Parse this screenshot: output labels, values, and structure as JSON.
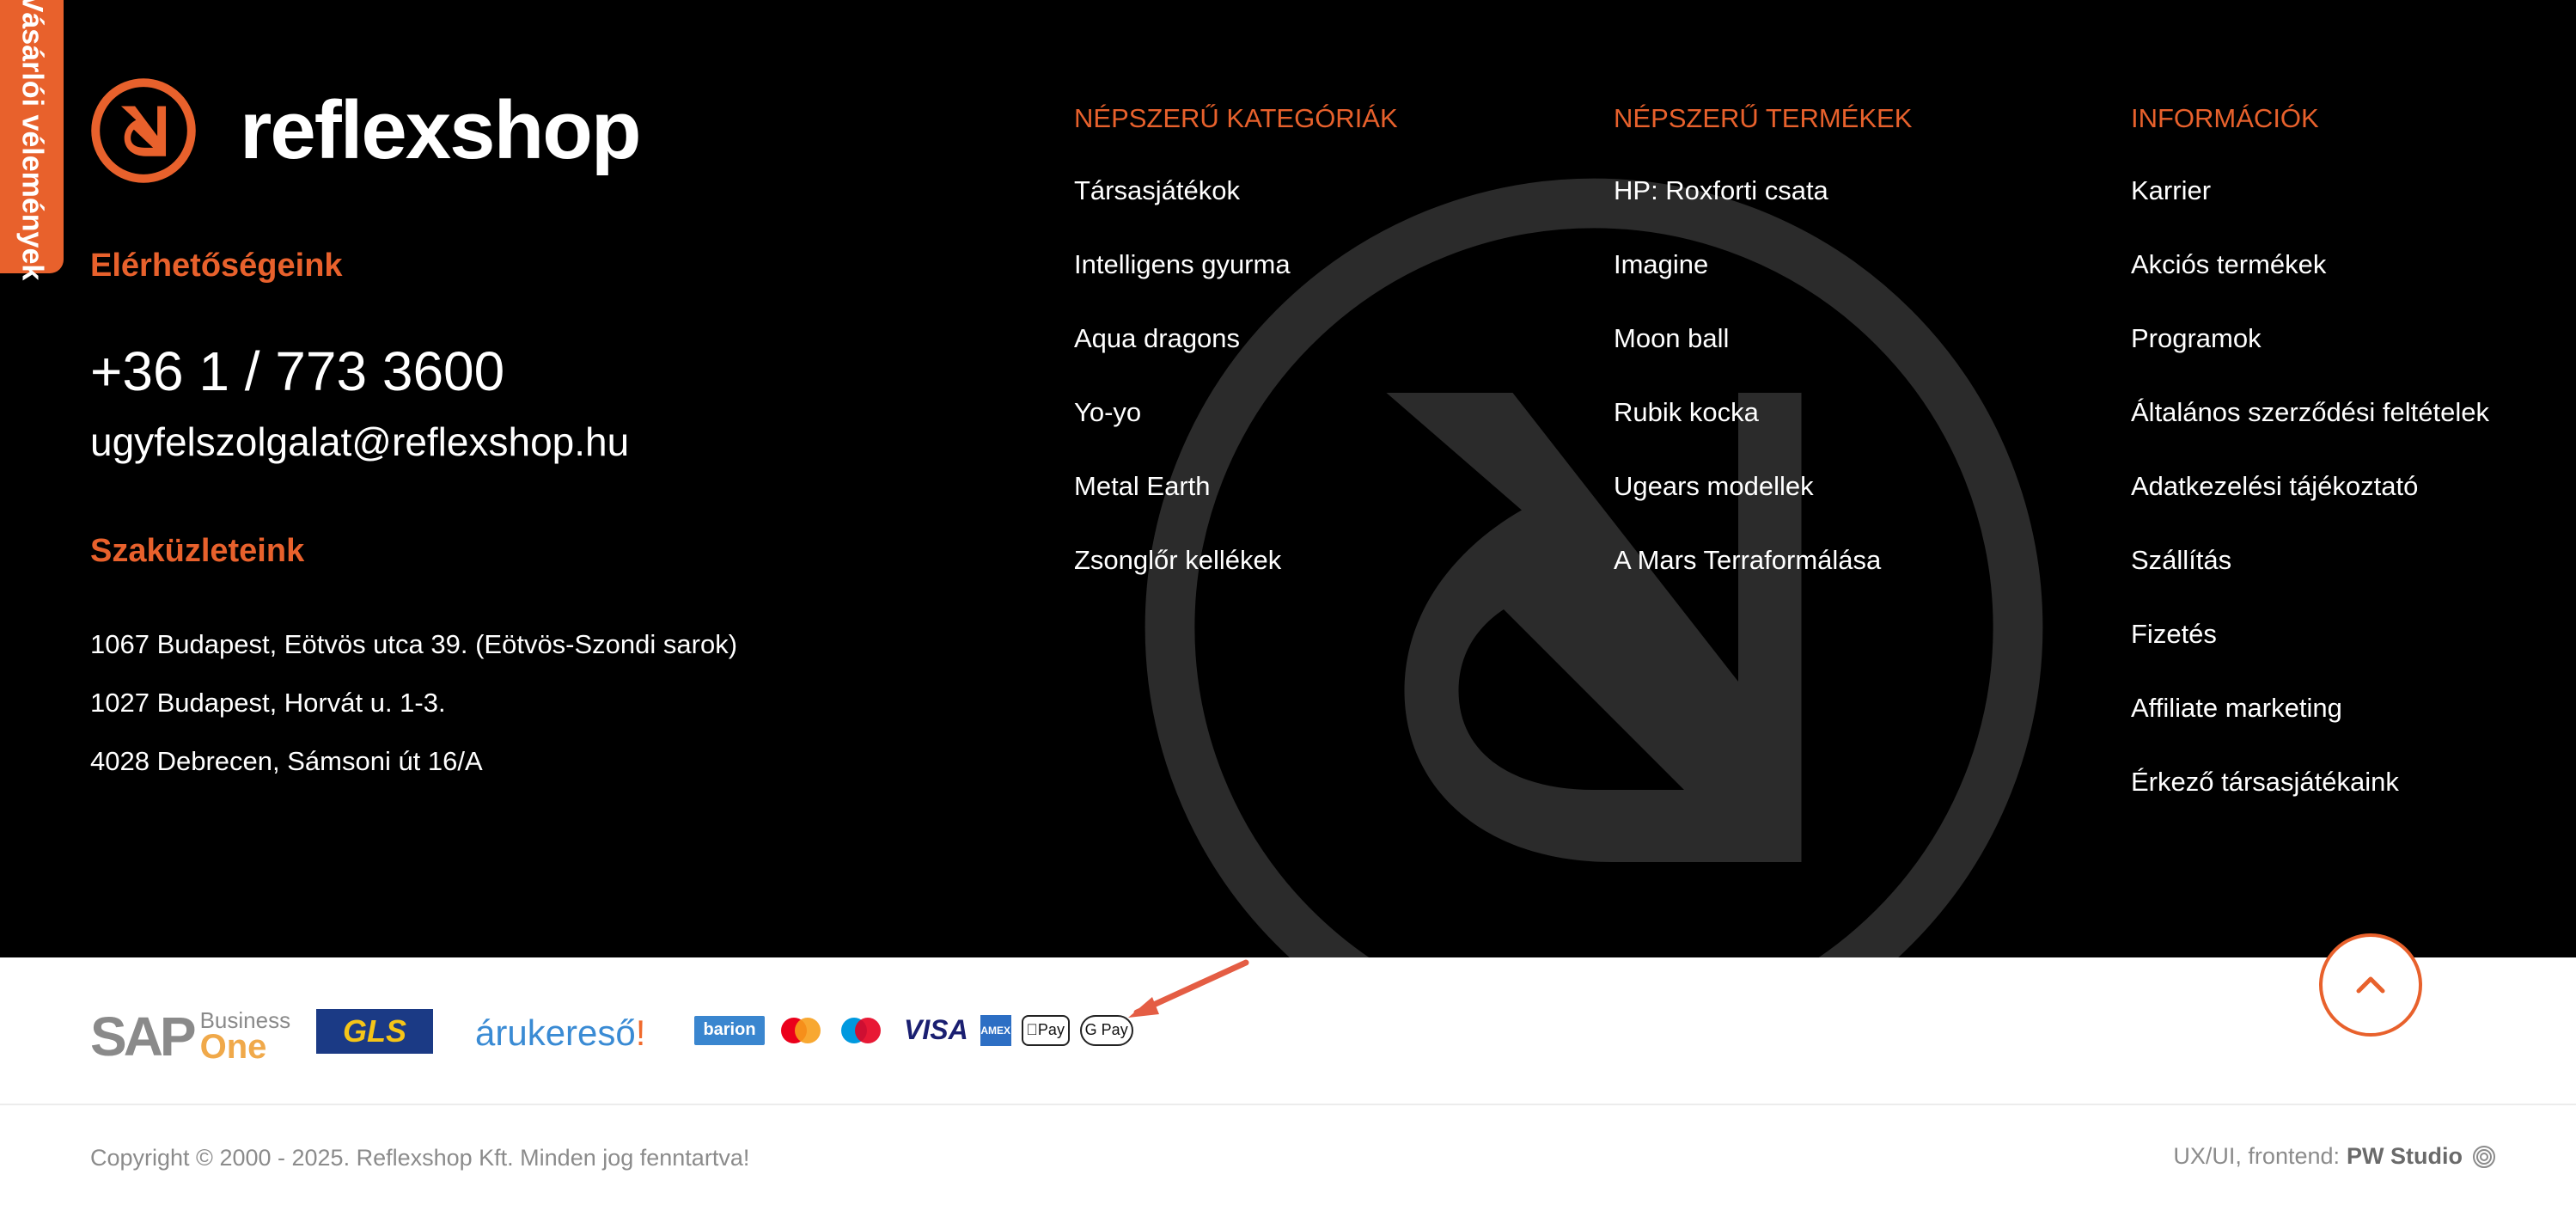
{
  "review_tab": {
    "label": "Vásárlói vélemények"
  },
  "brand": {
    "name": "reflexshop"
  },
  "contact": {
    "title": "Elérhetőségeink",
    "phone": "+36 1 / 773 3600",
    "email": "ugyfelszolgalat@reflexshop.hu"
  },
  "stores": {
    "title": "Szaküzleteink",
    "items": [
      "1067 Budapest, Eötvös utca 39. (Eötvös-Szondi sarok)",
      "1027 Budapest, Horvát u. 1-3.",
      "4028 Debrecen, Sámsoni út 16/A"
    ]
  },
  "columns": [
    {
      "title": "NÉPSZERŰ KATEGÓRIÁK",
      "items": [
        "Társasjátékok",
        "Intelligens gyurma",
        "Aqua dragons",
        "Yo-yo",
        "Metal Earth",
        "Zsonglőr kellékek"
      ]
    },
    {
      "title": "NÉPSZERŰ TERMÉKEK",
      "items": [
        "HP: Roxforti csata",
        "Imagine",
        "Moon ball",
        "Rubik kocka",
        "Ugears modellek",
        "A Mars Terraformálása"
      ]
    },
    {
      "title": "INFORMÁCIÓK",
      "items": [
        "Karrier",
        "Akciós termékek",
        "Programok",
        "Általános szerződési feltételek",
        "Adatkezelési tájékoztató",
        "Szállítás",
        "Fizetés",
        "Affiliate marketing",
        "Érkező társasjátékaink"
      ]
    }
  ],
  "partners": {
    "sap_word": "SAP",
    "sap_business": "Business",
    "sap_one": "One",
    "gls": "GLS",
    "arukereso": "árukereső",
    "arukereso_bang": "!"
  },
  "payments": {
    "barion": "barion",
    "visa": "VISA",
    "amex": "AMEX",
    "apple_pay": "Pay",
    "google_pay": "G Pay"
  },
  "footer": {
    "copyright": "Copyright © 2000 - 2025. Reflexshop Kft. Minden jog fenntartva!",
    "credit_prefix": "UX/UI, frontend:",
    "credit_studio": "PW Studio"
  },
  "colors": {
    "accent": "#e8612c",
    "background": "#000000",
    "watermark": "#2b2b2b",
    "text_light": "#ffffff",
    "text_muted": "#8b8b8b"
  }
}
